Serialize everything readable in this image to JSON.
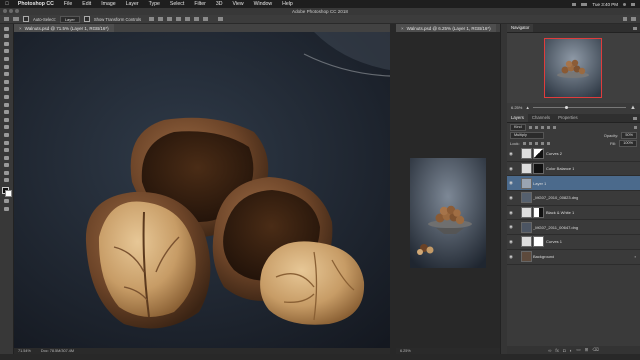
{
  "menubar": {
    "app": "Photoshop CC",
    "items": [
      "File",
      "Edit",
      "Image",
      "Layer",
      "Type",
      "Select",
      "Filter",
      "3D",
      "View",
      "Window",
      "Help"
    ],
    "clock": "Tue 3:40 PM"
  },
  "titlebar": {
    "title": "Adobe Photoshop CC 2018"
  },
  "options": {
    "auto_select_label": "Auto-Select:",
    "auto_select_value": "Layer",
    "transform_label": "Show Transform Controls"
  },
  "doc1": {
    "tab": "Walnuts.psd @ 71.5% (Layer 1, RGB/16*)",
    "zoom": "71.54%",
    "doc_info": "Doc: 78.5M/307.4M"
  },
  "doc2": {
    "tab": "Walnuts.psd @ 6.25% (Layer 1, RGB/16*)",
    "zoom": "6.25%"
  },
  "navigator": {
    "tabs": [
      "Navigator"
    ],
    "zoom": "6.25%"
  },
  "layers_panel": {
    "tabs": [
      "Layers",
      "Channels",
      "Properties"
    ],
    "filter_label": "Kind",
    "blend_mode": "Multiply",
    "opacity_label": "Opacity:",
    "opacity_value": "50%",
    "lock_label": "Lock:",
    "fill_label": "Fill:",
    "fill_value": "100%",
    "layers": [
      {
        "name": "Curves 2",
        "type": "adjustment",
        "thumb": "#ddd",
        "mask": true,
        "selected": false
      },
      {
        "name": "Color Balance 1",
        "type": "adjustment",
        "thumb": "#ddd",
        "mask": true,
        "selected": false
      },
      {
        "name": "Layer 1",
        "type": "pixel",
        "thumb": "#9aa4b2",
        "mask": false,
        "selected": true
      },
      {
        "name": "_MG07_2010_00823.dng",
        "type": "pixel",
        "thumb": "#55606e",
        "mask": false,
        "selected": false
      },
      {
        "name": "Black & White 1",
        "type": "adjustment",
        "thumb": "#ddd",
        "mask": true,
        "selected": false
      },
      {
        "name": "_MG07_2011_00647.dng",
        "type": "pixel",
        "thumb": "#4c5563",
        "mask": false,
        "selected": false
      },
      {
        "name": "Curves 1",
        "type": "adjustment",
        "thumb": "#ddd",
        "mask": true,
        "selected": false
      },
      {
        "name": "Background",
        "type": "background",
        "thumb": "#5d4a3c",
        "mask": false,
        "selected": false
      }
    ],
    "footer_icons": [
      "link-icon",
      "fx-icon",
      "mask-icon",
      "adjustment-icon",
      "folder-icon",
      "new-layer-icon",
      "trash-icon"
    ]
  },
  "colors": {
    "selection": "#4b6a8c",
    "nav_frame": "#e03c3c",
    "canvas_bg": "#1a1d22"
  }
}
